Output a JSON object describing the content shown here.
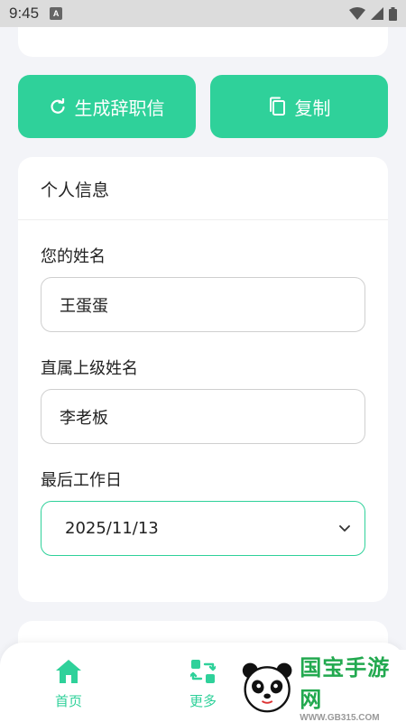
{
  "status_bar": {
    "time": "9:45",
    "notif_letter": "A"
  },
  "actions": {
    "generate_label": "生成辞职信",
    "copy_label": "复制"
  },
  "personal_info": {
    "section_title": "个人信息",
    "name_label": "您的姓名",
    "name_value": "王蛋蛋",
    "supervisor_label": "直属上级姓名",
    "supervisor_value": "李老板",
    "last_day_label": "最后工作日",
    "last_day_value": "2025/11/13"
  },
  "nav": {
    "home_label": "首页",
    "more_label": "更多"
  },
  "watermark": {
    "title": "国宝手游网",
    "url": "WWW.GB315.COM"
  },
  "colors": {
    "accent": "#2fd19a",
    "background": "#f3f4f8",
    "card": "#ffffff"
  }
}
